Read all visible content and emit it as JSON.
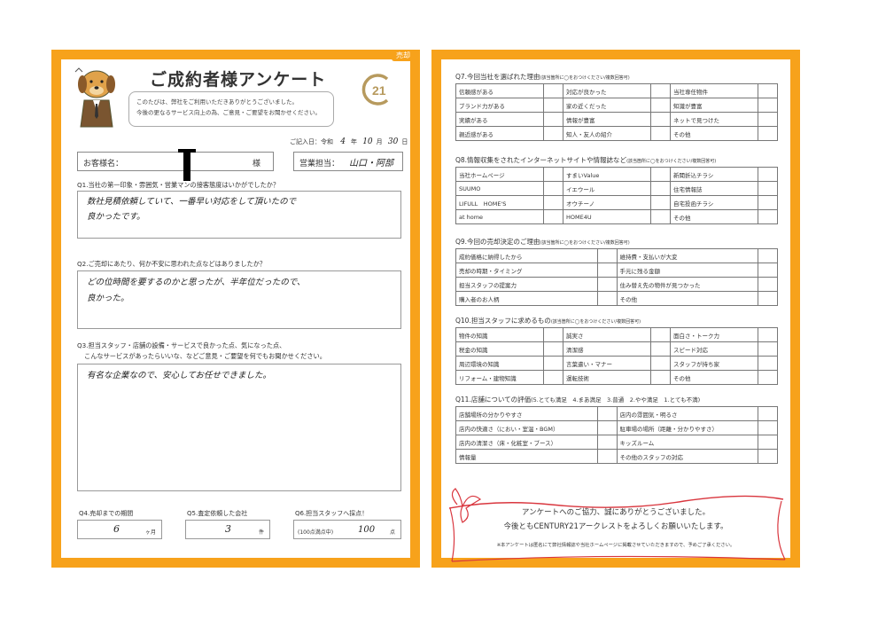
{
  "left": {
    "tag": "売却",
    "title": "ご成約者様アンケート",
    "intro": {
      "line1": "このたびは、弊社をご利用いただきありがとうございました。",
      "line2": "今後の更なるサービス向上の為、ご意見・ご要望をお聞かせください。"
    },
    "date": {
      "label": "ご記入日：",
      "era": "令和",
      "year": "4",
      "year_unit": "年",
      "month": "10",
      "month_unit": "月",
      "day": "30",
      "day_unit": "日"
    },
    "customer": {
      "label": "お客様名：",
      "suffix": "様"
    },
    "staff": {
      "label": "営業担当：",
      "value": "山口・阿部"
    },
    "q1": {
      "question": "Q1.当社の第一印象・雰囲気・営業マンの接客態度はいかがでしたか？",
      "answer_line1": "数社見積依頼していて、一番早い対応をして頂いたので",
      "answer_line2": "良かったです。"
    },
    "q2": {
      "question": "Q2.ご売却にあたり、何か不安に思われた点などはありましたか？",
      "answer_line1": "どの位時間を要するのかと思ったが、半年位だったので、",
      "answer_line2": "良かった。"
    },
    "q3": {
      "question_line1": "Q3.担当スタッフ・店舗の設備・サービスで良かった点、気になった点、",
      "question_line2": "こんなサービスがあったらいいな、などご意見・ご要望を何でもお聞かせください。",
      "answer": "有名な企業なので、安心してお任せできました。"
    },
    "q4": {
      "question": "Q4.売却までの期間",
      "value": "6",
      "unit": "ヶ月"
    },
    "q5": {
      "question": "Q5.査定依頼した会社",
      "value": "3",
      "unit": "件"
    },
    "q6": {
      "question": "Q6.担当スタッフへ採点！",
      "prefix": "(100点満点中)",
      "value": "100",
      "unit": "点"
    }
  },
  "right": {
    "q7": {
      "title": "Q7.今回当社を選ばれた理由",
      "note": "(該当箇所に◯をおつけください/複数回答可)",
      "rows": [
        [
          "信頼感がある",
          "対応が良かった",
          "当社専任物件"
        ],
        [
          "ブランド力がある",
          "家の近くだった",
          "知識が豊富"
        ],
        [
          "実績がある",
          "情報が豊富",
          "ネットで見つけた"
        ],
        [
          "親近感がある",
          "知人・友人の紹介",
          "その他"
        ]
      ]
    },
    "q8": {
      "title": "Q8.情報収集をされたインターネットサイトや情報誌など",
      "note": "(該当箇所に◯をおつけください/複数回答可)",
      "rows": [
        [
          "当社ホームページ",
          "すまいValue",
          "新聞折込チラシ"
        ],
        [
          "SUUMO",
          "イエウール",
          "住宅情報誌"
        ],
        [
          "LIFULL　HOME'S",
          "オウチーノ",
          "自宅投函チラシ"
        ],
        [
          "at home",
          "HOME4U",
          "その他"
        ]
      ]
    },
    "q9": {
      "title": "Q9.今回の売却決定のご理由",
      "note": "(該当箇所に◯をおつけください/複数回答可)",
      "rows": [
        [
          "成約価格に納得したから",
          "維持費・支払いが大変"
        ],
        [
          "売却の時期・タイミング",
          "手元に残る金額"
        ],
        [
          "担当スタッフの提案力",
          "住み替え先の物件が見つかった"
        ],
        [
          "購入者のお人柄",
          "その他"
        ]
      ]
    },
    "q10": {
      "title": "Q10.担当スタッフに求めるもの",
      "note": "(該当箇所に◯をおつけください/複数回答可)",
      "rows": [
        [
          "物件の知識",
          "誠実さ",
          "面白さ・トーク力"
        ],
        [
          "税金の知識",
          "清潔感",
          "スピード対応"
        ],
        [
          "周辺環境の知識",
          "言葉遣い・マナー",
          "スタッフが持ち家"
        ],
        [
          "リフォーム・建物知識",
          "運転技術",
          "その他"
        ]
      ]
    },
    "q11": {
      "title": "Q11.店舗についての評価",
      "scale": "(5.とても満足　4.まあ満足　3.普通　2.やや満足　1.とても不満)",
      "rows": [
        [
          "店舗場所の分かりやすさ",
          "店内の雰囲気・明るさ"
        ],
        [
          "店内の快適さ（におい・室温・BGM）",
          "駐車場の場所（距離・分かりやすさ）"
        ],
        [
          "店内の清潔さ（床・化粧室・ブース）",
          "キッズルーム"
        ],
        [
          "情報量",
          "その他のスタッフの対応"
        ]
      ]
    },
    "thanks": {
      "line1": "アンケートへのご協力、誠にありがとうございました。",
      "line2": "今後ともCENTURY21アークレストをよろしくお願いいたします。",
      "note": "※本アンケートは匿名にて弊社情報誌や当社ホームページに掲載させていただきますので、予めご了承ください。"
    }
  },
  "colors": {
    "frame": "#f7a21b",
    "ribbon": "#d9363e",
    "logo": "#b79a5e"
  },
  "icons": {
    "mascot": "dog-mascot-icon",
    "logo": "century21-logo-icon"
  }
}
